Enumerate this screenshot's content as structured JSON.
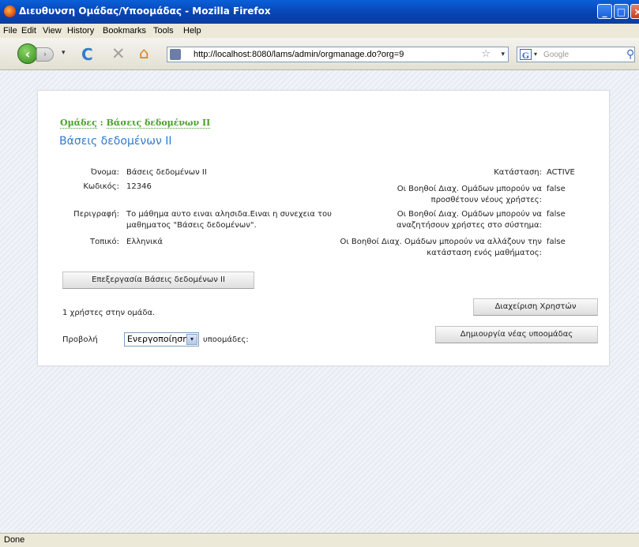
{
  "window": {
    "title": "Διευθυνση Ομάδας/Υποομάδας - Mozilla Firefox",
    "min": "_",
    "max": "□",
    "close": "×"
  },
  "menu": [
    "File",
    "Edit",
    "View",
    "History",
    "Bookmarks",
    "Tools",
    "Help"
  ],
  "nav": {
    "url": "http://localhost:8080/lams/admin/orgmanage.do?org=9",
    "search_placeholder": "Google",
    "back": "‹",
    "forward": "›",
    "dropdown": "▾",
    "reload": "C",
    "stop": "✕",
    "home": "⌂",
    "star": "☆",
    "search": "⚲",
    "g": "G"
  },
  "breadcrumb": {
    "root": "Ομάδες",
    "separator": " : ",
    "current": "Βάσεις δεδομένων ΙΙ"
  },
  "page_title": "Βάσεις δεδομένων ΙΙ",
  "details": {
    "name_label": "Όνομα:",
    "name_value": "Βάσεις δεδομένων ΙΙ",
    "code_label": "Κωδικός:",
    "code_value": "12346",
    "desc_label": "Περιγραφή:",
    "desc_value": "Το μάθημα αυτο ειναι αλησιδα.Ειναι η συνεχεια του μαθηματος \"Βάσεις δεδομένων\".",
    "locale_label": "Τοπικό:",
    "locale_value": "Ελληνικά"
  },
  "settings": {
    "status_label": "Κατάσταση:",
    "status_value": "ACTIVE",
    "add_label": "Οι Βοηθοί Διαχ. Ομάδων μπορούν να προσθέτουν νέους χρήστες:",
    "add_value": "false",
    "search_label": "Οι Βοηθοί Διαχ. Ομάδων μπορούν να αναζητήσουν χρήστες στο σύστημα:",
    "search_value": "false",
    "change_label": "Οι Βοηθοί Διαχ. Ομάδων μπορούν να αλλάζουν την κατάσταση ενός μαθήματος:",
    "change_value": "false"
  },
  "buttons": {
    "edit": "Επεξεργασία Βάσεις δεδομένων ΙΙ",
    "manage_users": "Διαχείριση Χρηστών",
    "create_subgroup": "Δημιουργία νέας υποομάδας"
  },
  "users_count_text": "1 χρήστες στην ομάδα.",
  "filter": {
    "prefix": "Προβολή",
    "selected": "Ενεργοποίηση",
    "suffix": "υποομάδες:",
    "arrow": "▾"
  },
  "status": "Done"
}
